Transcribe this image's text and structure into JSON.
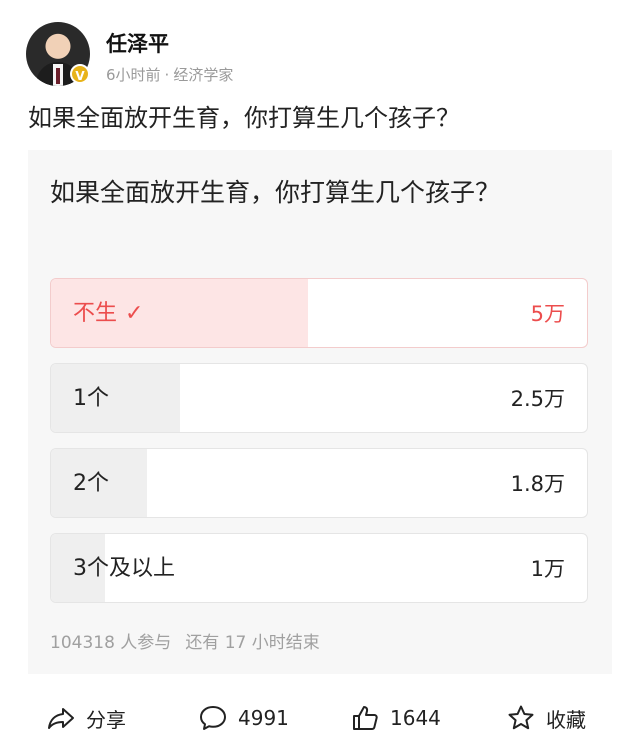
{
  "author": {
    "name": "任泽平",
    "time": "6小时前",
    "separator": "·",
    "title": "经济学家",
    "verified_badge": "V"
  },
  "post": {
    "title": "如果全面放开生育，你打算生几个孩子？"
  },
  "poll": {
    "question": "如果全面放开生育，你打算生几个孩子？",
    "selected_check": "✓",
    "options": [
      {
        "label": "不生",
        "count": "5万",
        "fraction": 0.48,
        "selected": true
      },
      {
        "label": "1个",
        "count": "2.5万",
        "fraction": 0.24,
        "selected": false
      },
      {
        "label": "2个",
        "count": "1.8万",
        "fraction": 0.18,
        "selected": false
      },
      {
        "label": "3个及以上",
        "count": "1万",
        "fraction": 0.1,
        "selected": false
      }
    ],
    "participants": "104318 人参与",
    "remaining": "还有 17 小时结束"
  },
  "actions": {
    "share_label": "分享",
    "comment_count": "4991",
    "like_count": "1644",
    "favorite_label": "收藏",
    "icons": [
      "share-icon",
      "comment-icon",
      "like-icon",
      "star-icon"
    ]
  },
  "colors": {
    "accent": "#ec4d4d",
    "selected_fill": "#fde5e5",
    "bar_fill": "#efefef",
    "card_bg": "#f7f7f7",
    "muted_text": "#a0a0a0",
    "verified": "#e8b31a"
  }
}
